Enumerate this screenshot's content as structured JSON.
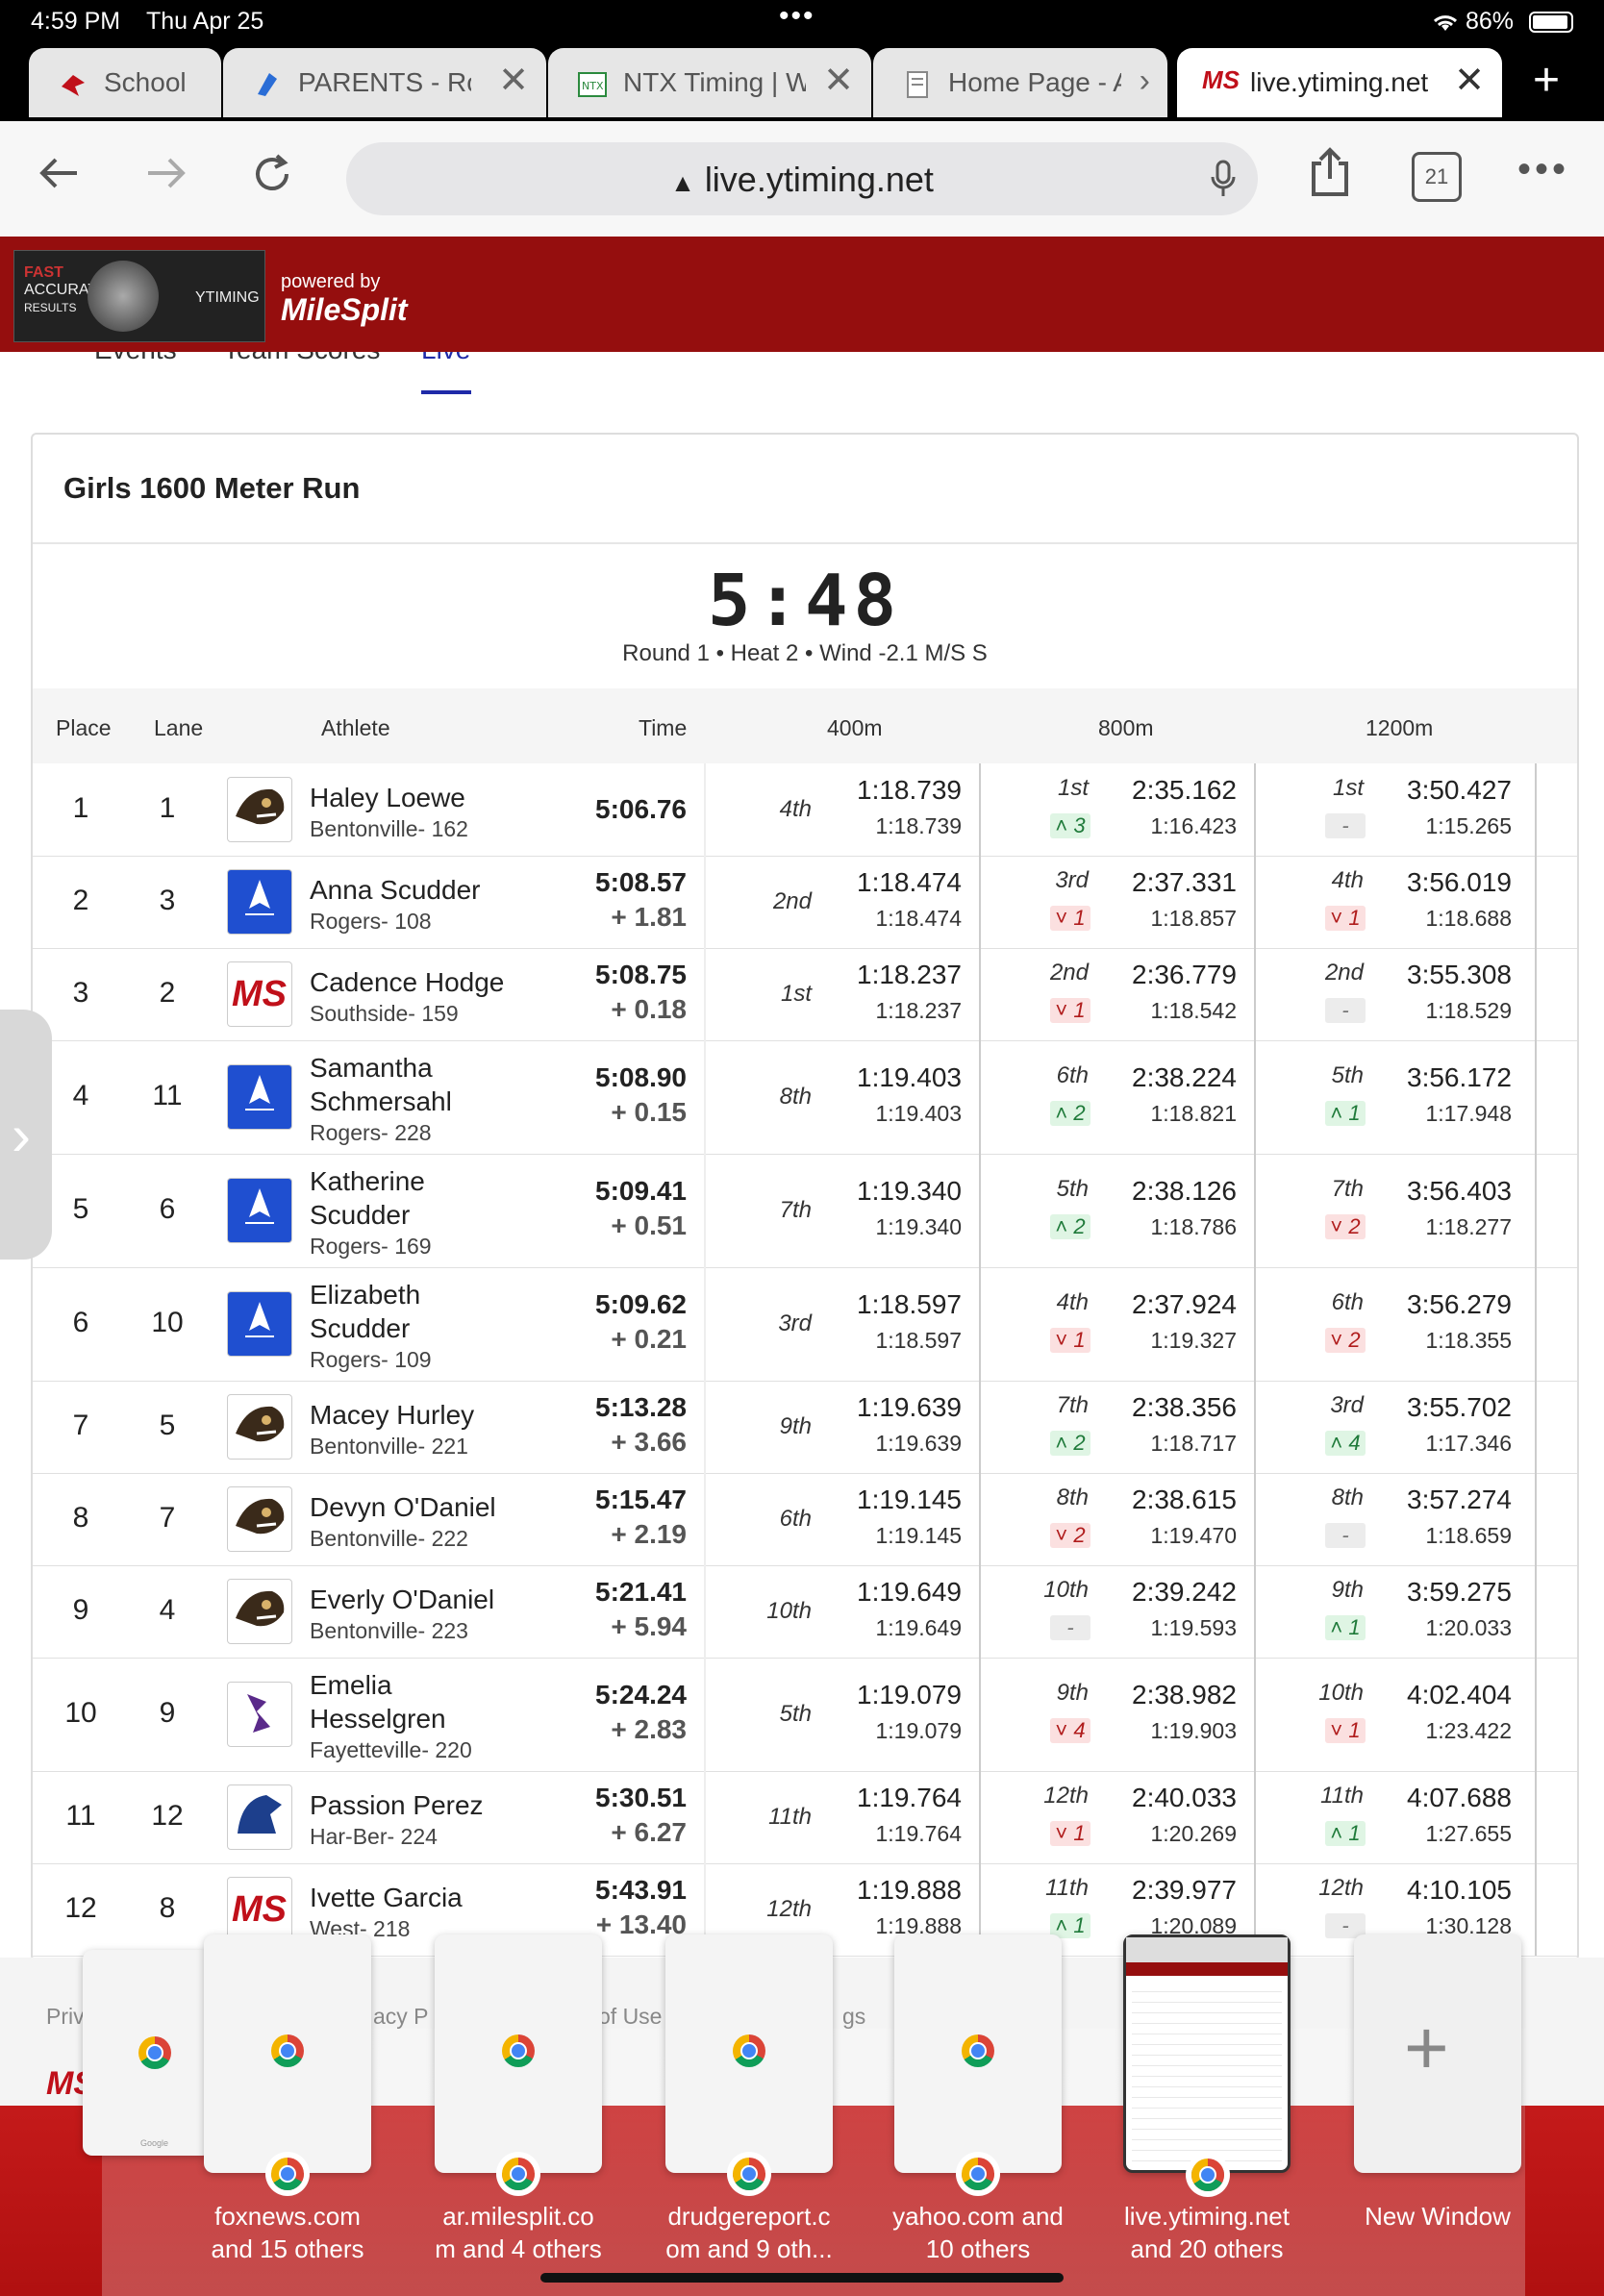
{
  "status": {
    "time": "4:59 PM",
    "date": "Thu Apr 25",
    "battery": "86%"
  },
  "tabs": [
    {
      "label": "School"
    },
    {
      "label": "PARENTS - Rog"
    },
    {
      "label": "NTX Timing | W"
    },
    {
      "label": "Home Page - A"
    },
    {
      "label": "live.ytiming.net",
      "active": true
    }
  ],
  "toolbar": {
    "url": "live.ytiming.net",
    "tab_count": "21"
  },
  "header": {
    "powered_by": "powered by",
    "brand": "MileSplit",
    "logo_text": [
      "FAST",
      "ACCURATE",
      "RESULTS",
      "YTIMING"
    ]
  },
  "nav": {
    "items": [
      "Events",
      "Team Scores",
      "Live"
    ],
    "active": "Live"
  },
  "event": {
    "title": "Girls 1600 Meter Run",
    "clock": "5:48",
    "info": "Round 1 • Heat 2 • Wind -2.1 M/S S"
  },
  "columns": [
    "Place",
    "Lane",
    "Athlete",
    "Time",
    "400m",
    "800m",
    "1200m"
  ],
  "rows": [
    {
      "place": "1",
      "lane": "1",
      "name": [
        "Haley Loewe"
      ],
      "team": "Bentonville- 162",
      "logo": "bentonville",
      "time": "5:06.76",
      "gap": "",
      "s400": {
        "rank": "4th",
        "split": "1:18.739",
        "lap": "1:18.739"
      },
      "s800": {
        "rank": "1st",
        "split": "2:35.162",
        "lap": "1:16.423",
        "chg": "3",
        "dir": "up"
      },
      "s1200": {
        "rank": "1st",
        "split": "3:50.427",
        "lap": "1:15.265",
        "chg": "-",
        "dir": "eq"
      }
    },
    {
      "place": "2",
      "lane": "3",
      "name": [
        "Anna Scudder"
      ],
      "team": "Rogers- 108",
      "logo": "rogers",
      "time": "5:08.57",
      "gap": "+ 1.81",
      "s400": {
        "rank": "2nd",
        "split": "1:18.474",
        "lap": "1:18.474"
      },
      "s800": {
        "rank": "3rd",
        "split": "2:37.331",
        "lap": "1:18.857",
        "chg": "1",
        "dir": "dn"
      },
      "s1200": {
        "rank": "4th",
        "split": "3:56.019",
        "lap": "1:18.688",
        "chg": "1",
        "dir": "dn"
      }
    },
    {
      "place": "3",
      "lane": "2",
      "name": [
        "Cadence Hodge"
      ],
      "team": "Southside- 159",
      "logo": "ms",
      "time": "5:08.75",
      "gap": "+ 0.18",
      "s400": {
        "rank": "1st",
        "split": "1:18.237",
        "lap": "1:18.237"
      },
      "s800": {
        "rank": "2nd",
        "split": "2:36.779",
        "lap": "1:18.542",
        "chg": "1",
        "dir": "dn"
      },
      "s1200": {
        "rank": "2nd",
        "split": "3:55.308",
        "lap": "1:18.529",
        "chg": "-",
        "dir": "eq"
      }
    },
    {
      "place": "4",
      "lane": "11",
      "name": [
        "Samantha",
        "Schmersahl"
      ],
      "team": "Rogers- 228",
      "logo": "rogers",
      "time": "5:08.90",
      "gap": "+ 0.15",
      "s400": {
        "rank": "8th",
        "split": "1:19.403",
        "lap": "1:19.403"
      },
      "s800": {
        "rank": "6th",
        "split": "2:38.224",
        "lap": "1:18.821",
        "chg": "2",
        "dir": "up"
      },
      "s1200": {
        "rank": "5th",
        "split": "3:56.172",
        "lap": "1:17.948",
        "chg": "1",
        "dir": "up"
      }
    },
    {
      "place": "5",
      "lane": "6",
      "name": [
        "Katherine",
        "Scudder"
      ],
      "team": "Rogers- 169",
      "logo": "rogers",
      "time": "5:09.41",
      "gap": "+ 0.51",
      "s400": {
        "rank": "7th",
        "split": "1:19.340",
        "lap": "1:19.340"
      },
      "s800": {
        "rank": "5th",
        "split": "2:38.126",
        "lap": "1:18.786",
        "chg": "2",
        "dir": "up"
      },
      "s1200": {
        "rank": "7th",
        "split": "3:56.403",
        "lap": "1:18.277",
        "chg": "2",
        "dir": "dn"
      }
    },
    {
      "place": "6",
      "lane": "10",
      "name": [
        "Elizabeth",
        "Scudder"
      ],
      "team": "Rogers- 109",
      "logo": "rogers",
      "time": "5:09.62",
      "gap": "+ 0.21",
      "s400": {
        "rank": "3rd",
        "split": "1:18.597",
        "lap": "1:18.597"
      },
      "s800": {
        "rank": "4th",
        "split": "2:37.924",
        "lap": "1:19.327",
        "chg": "1",
        "dir": "dn"
      },
      "s1200": {
        "rank": "6th",
        "split": "3:56.279",
        "lap": "1:18.355",
        "chg": "2",
        "dir": "dn"
      }
    },
    {
      "place": "7",
      "lane": "5",
      "name": [
        "Macey Hurley"
      ],
      "team": "Bentonville- 221",
      "logo": "bentonville",
      "time": "5:13.28",
      "gap": "+ 3.66",
      "s400": {
        "rank": "9th",
        "split": "1:19.639",
        "lap": "1:19.639"
      },
      "s800": {
        "rank": "7th",
        "split": "2:38.356",
        "lap": "1:18.717",
        "chg": "2",
        "dir": "up"
      },
      "s1200": {
        "rank": "3rd",
        "split": "3:55.702",
        "lap": "1:17.346",
        "chg": "4",
        "dir": "up"
      }
    },
    {
      "place": "8",
      "lane": "7",
      "name": [
        "Devyn O'Daniel"
      ],
      "team": "Bentonville- 222",
      "logo": "bentonville",
      "time": "5:15.47",
      "gap": "+ 2.19",
      "s400": {
        "rank": "6th",
        "split": "1:19.145",
        "lap": "1:19.145"
      },
      "s800": {
        "rank": "8th",
        "split": "2:38.615",
        "lap": "1:19.470",
        "chg": "2",
        "dir": "dn"
      },
      "s1200": {
        "rank": "8th",
        "split": "3:57.274",
        "lap": "1:18.659",
        "chg": "-",
        "dir": "eq"
      }
    },
    {
      "place": "9",
      "lane": "4",
      "name": [
        "Everly O'Daniel"
      ],
      "team": "Bentonville- 223",
      "logo": "bentonville",
      "time": "5:21.41",
      "gap": "+ 5.94",
      "s400": {
        "rank": "10th",
        "split": "1:19.649",
        "lap": "1:19.649"
      },
      "s800": {
        "rank": "10th",
        "split": "2:39.242",
        "lap": "1:19.593",
        "chg": "-",
        "dir": "eq"
      },
      "s1200": {
        "rank": "9th",
        "split": "3:59.275",
        "lap": "1:20.033",
        "chg": "1",
        "dir": "up"
      }
    },
    {
      "place": "10",
      "lane": "9",
      "name": [
        "Emelia",
        "Hesselgren"
      ],
      "team": "Fayetteville- 220",
      "logo": "fayetteville",
      "time": "5:24.24",
      "gap": "+ 2.83",
      "s400": {
        "rank": "5th",
        "split": "1:19.079",
        "lap": "1:19.079"
      },
      "s800": {
        "rank": "9th",
        "split": "2:38.982",
        "lap": "1:19.903",
        "chg": "4",
        "dir": "dn"
      },
      "s1200": {
        "rank": "10th",
        "split": "4:02.404",
        "lap": "1:23.422",
        "chg": "1",
        "dir": "dn"
      }
    },
    {
      "place": "11",
      "lane": "12",
      "name": [
        "Passion Perez"
      ],
      "team": "Har-Ber- 224",
      "logo": "harber",
      "time": "5:30.51",
      "gap": "+ 6.27",
      "s400": {
        "rank": "11th",
        "split": "1:19.764",
        "lap": "1:19.764"
      },
      "s800": {
        "rank": "12th",
        "split": "2:40.033",
        "lap": "1:20.269",
        "chg": "1",
        "dir": "dn"
      },
      "s1200": {
        "rank": "11th",
        "split": "4:07.688",
        "lap": "1:27.655",
        "chg": "1",
        "dir": "up"
      }
    },
    {
      "place": "12",
      "lane": "8",
      "name": [
        "Ivette Garcia"
      ],
      "team": "West- 218",
      "logo": "ms",
      "time": "5:43.91",
      "gap": "+ 13.40",
      "s400": {
        "rank": "12th",
        "split": "1:19.888",
        "lap": "1:19.888"
      },
      "s800": {
        "rank": "11th",
        "split": "2:39.977",
        "lap": "1:20.089",
        "chg": "1",
        "dir": "up"
      },
      "s1200": {
        "rank": "12th",
        "split": "4:10.105",
        "lap": "1:30.128",
        "chg": "-",
        "dir": "eq"
      }
    }
  ],
  "footer": {
    "links": [
      "Priv",
      "acy P",
      "of Use",
      "gs"
    ]
  },
  "switcher": {
    "windows": [
      {
        "label": "foxnews.com\nand 15 others"
      },
      {
        "label": "ar.milesplit.co\nm and 4 others"
      },
      {
        "label": "drudgereport.c\nom and 9 oth..."
      },
      {
        "label": "yahoo.com and\n10 others"
      },
      {
        "label": "live.ytiming.net\nand 20 others"
      },
      {
        "label": "New Window"
      }
    ],
    "back_window_caption": "Google"
  },
  "colors": {
    "header_red": "#950e0e",
    "nav_active": "#1f2aa8",
    "up_green": "#1f7a3a",
    "down_red": "#b01c1c"
  }
}
